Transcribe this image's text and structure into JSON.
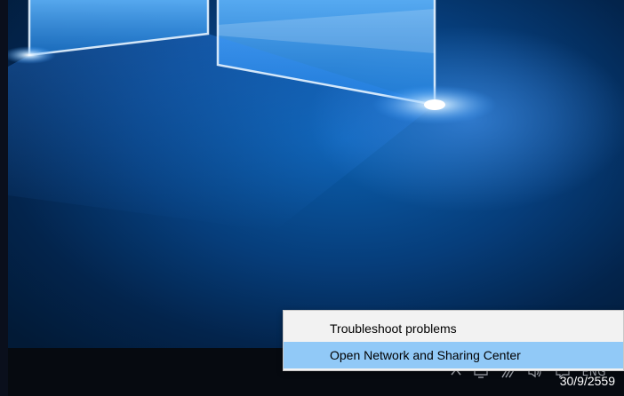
{
  "context_menu": {
    "items": [
      {
        "label": "Troubleshoot problems",
        "highlighted": false
      },
      {
        "label": "Open Network and Sharing Center",
        "highlighted": true
      }
    ]
  },
  "taskbar": {
    "tray_icons": [
      "chevron-up-icon",
      "monitor-icon",
      "network-icon",
      "volume-icon",
      "notification-icon"
    ],
    "language": "ENG",
    "date": "30/9/2559"
  },
  "colors": {
    "menu_background": "#f2f2f2",
    "menu_highlight": "#91c9f7",
    "taskbar": "#060a10",
    "wallpaper_blue": "#0b5fae"
  }
}
